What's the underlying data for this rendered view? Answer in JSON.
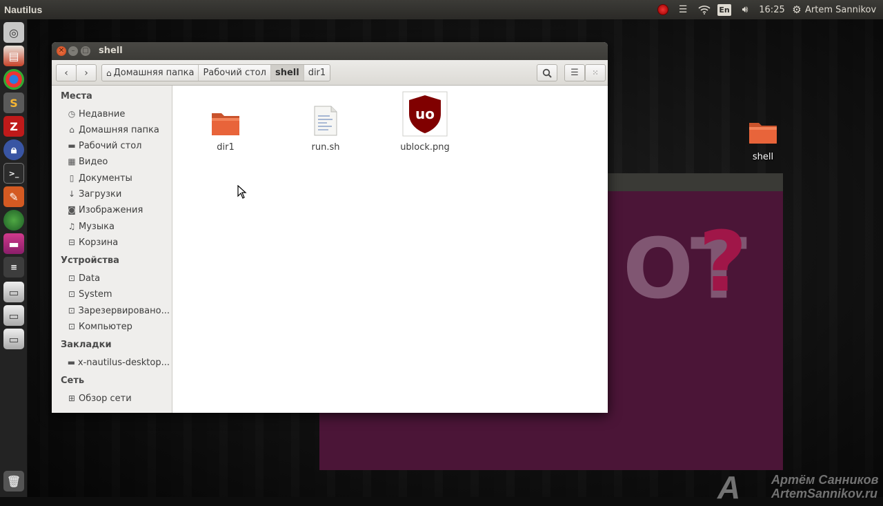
{
  "topbar": {
    "app_name": "Nautilus",
    "keyboard_layout": "En",
    "time": "16:25",
    "user": "Artem Sannikov"
  },
  "window": {
    "title": "shell",
    "breadcrumbs": [
      {
        "label": "Домашняя папка",
        "icon": "home-icon"
      },
      {
        "label": "Рабочий стол"
      },
      {
        "label": "shell"
      },
      {
        "label": "dir1"
      }
    ]
  },
  "sidebar": {
    "sections": [
      {
        "title": "Места",
        "items": [
          {
            "label": "Недавние",
            "icon": "clock-icon"
          },
          {
            "label": "Домашняя папка",
            "icon": "home-icon"
          },
          {
            "label": "Рабочий стол",
            "icon": "desktop-folder-icon"
          },
          {
            "label": "Видео",
            "icon": "film-icon"
          },
          {
            "label": "Документы",
            "icon": "document-icon"
          },
          {
            "label": "Загрузки",
            "icon": "download-icon"
          },
          {
            "label": "Изображения",
            "icon": "camera-icon"
          },
          {
            "label": "Музыка",
            "icon": "music-icon"
          },
          {
            "label": "Корзина",
            "icon": "trash-icon"
          }
        ]
      },
      {
        "title": "Устройства",
        "items": [
          {
            "label": "Data",
            "icon": "drive-icon"
          },
          {
            "label": "System",
            "icon": "drive-icon"
          },
          {
            "label": "Зарезервировано...",
            "icon": "drive-icon"
          },
          {
            "label": "Компьютер",
            "icon": "drive-icon"
          }
        ]
      },
      {
        "title": "Закладки",
        "items": [
          {
            "label": "x-nautilus-desktop...",
            "icon": "folder-icon"
          }
        ]
      },
      {
        "title": "Сеть",
        "items": [
          {
            "label": "Обзор сети",
            "icon": "network-icon"
          }
        ]
      }
    ]
  },
  "files": [
    {
      "name": "dir1",
      "icon": "folder-icon"
    },
    {
      "name": "run.sh",
      "icon": "script-file-icon"
    },
    {
      "name": "ublock.png",
      "icon": "ublock-image-icon"
    }
  ],
  "desktop": {
    "folder_label": "shell",
    "watermark_line1": "Артём Санников",
    "watermark_line2": "ArtemSannikov.ru"
  },
  "colors": {
    "folder": "#e8643a",
    "ublock": "#800000",
    "purple_bg": "#4b1537"
  }
}
